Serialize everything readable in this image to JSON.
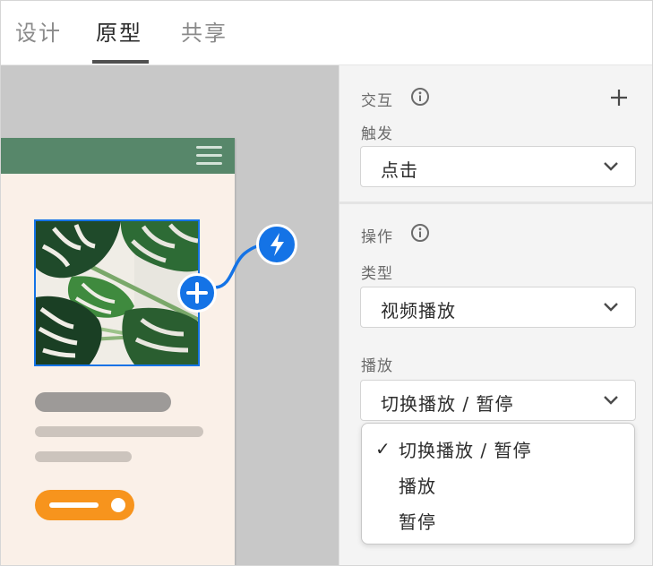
{
  "tabs": [
    {
      "label": "设计",
      "active": false
    },
    {
      "label": "原型",
      "active": true
    },
    {
      "label": "共享",
      "active": false
    }
  ],
  "interaction": {
    "section_label": "交互",
    "trigger_label": "触发",
    "trigger_value": "点击"
  },
  "action": {
    "section_label": "操作",
    "type_label": "类型",
    "type_value": "视频播放",
    "playback_label": "播放",
    "playback_value": "切换播放 / 暂停",
    "options": [
      "切换播放 / 暂停",
      "播放",
      "暂停"
    ],
    "selected_option": "切换播放 / 暂停",
    "check_glyph": "✓"
  },
  "icons": {
    "info": "info-icon",
    "add": "plus-icon",
    "chevron": "chevron-down-icon",
    "bolt": "lightning-icon",
    "menu": "hamburger-menu-icon"
  },
  "colors": {
    "accent": "#1473e6",
    "artboard_header": "#57876a",
    "artboard_bg": "#faf0e8",
    "toggle": "#f7941d",
    "canvas": "#c8c8c8",
    "panel": "#f4f4f4"
  }
}
